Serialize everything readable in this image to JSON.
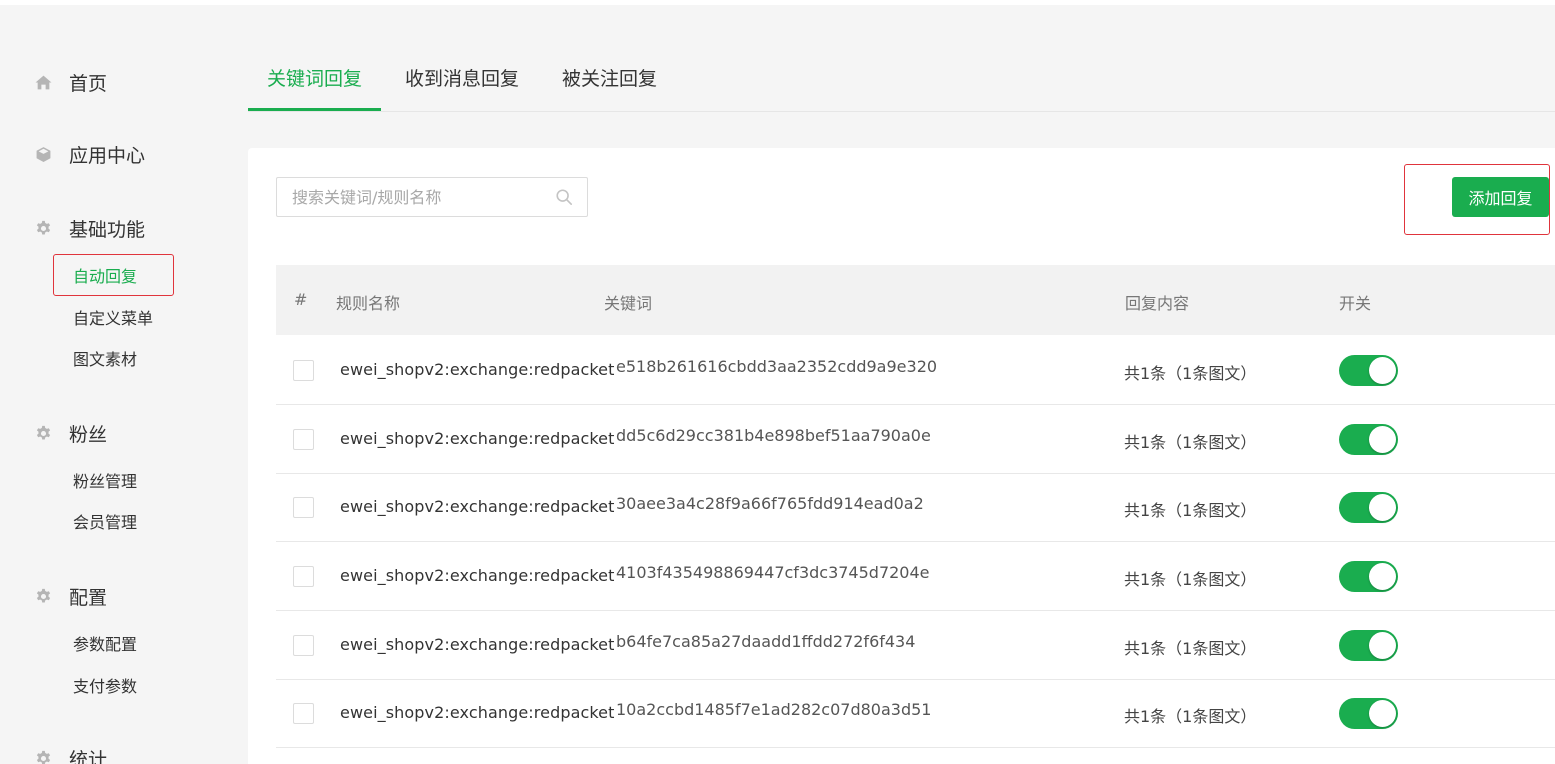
{
  "sidebar": {
    "home": "首页",
    "app_center": "应用中心",
    "basic": {
      "label": "基础功能",
      "items": [
        "自动回复",
        "自定义菜单",
        "图文素材"
      ]
    },
    "fans": {
      "label": "粉丝",
      "items": [
        "粉丝管理",
        "会员管理"
      ]
    },
    "config": {
      "label": "配置",
      "items": [
        "参数配置",
        "支付参数"
      ]
    },
    "stats": {
      "label": "统计"
    }
  },
  "tabs": [
    "关键词回复",
    "收到消息回复",
    "被关注回复"
  ],
  "search": {
    "placeholder": "搜索关键词/规则名称",
    "value": ""
  },
  "add_button": "添加回复",
  "table": {
    "headers": {
      "index": "#",
      "name": "规则名称",
      "keyword": "关键词",
      "content": "回复内容",
      "switch": "开关"
    },
    "rows": [
      {
        "name": "ewei_shopv2:exchange:redpacket",
        "keyword": "e518b261616cbdd3aa2352cdd9a9e320",
        "content": "共1条（1条图文）",
        "enabled": true
      },
      {
        "name": "ewei_shopv2:exchange:redpacket",
        "keyword": "dd5c6d29cc381b4e898bef51aa790a0e",
        "content": "共1条（1条图文）",
        "enabled": true
      },
      {
        "name": "ewei_shopv2:exchange:redpacket",
        "keyword": "30aee3a4c28f9a66f765fdd914ead0a2",
        "content": "共1条（1条图文）",
        "enabled": true
      },
      {
        "name": "ewei_shopv2:exchange:redpacket",
        "keyword": "4103f435498869447cf3dc3745d7204e",
        "content": "共1条（1条图文）",
        "enabled": true
      },
      {
        "name": "ewei_shopv2:exchange:redpacket",
        "keyword": "b64fe7ca85a27daadd1ffdd272f6f434",
        "content": "共1条（1条图文）",
        "enabled": true
      },
      {
        "name": "ewei_shopv2:exchange:redpacket",
        "keyword": "10a2ccbd1485f7e1ad282c07d80a3d51",
        "content": "共1条（1条图文）",
        "enabled": true
      }
    ]
  },
  "colors": {
    "accent": "#1aad4f",
    "highlight": "#e0343c"
  },
  "icons": {
    "home": "home-icon",
    "app_center": "cube-icon",
    "section": "gear-icon",
    "search": "search-icon"
  }
}
